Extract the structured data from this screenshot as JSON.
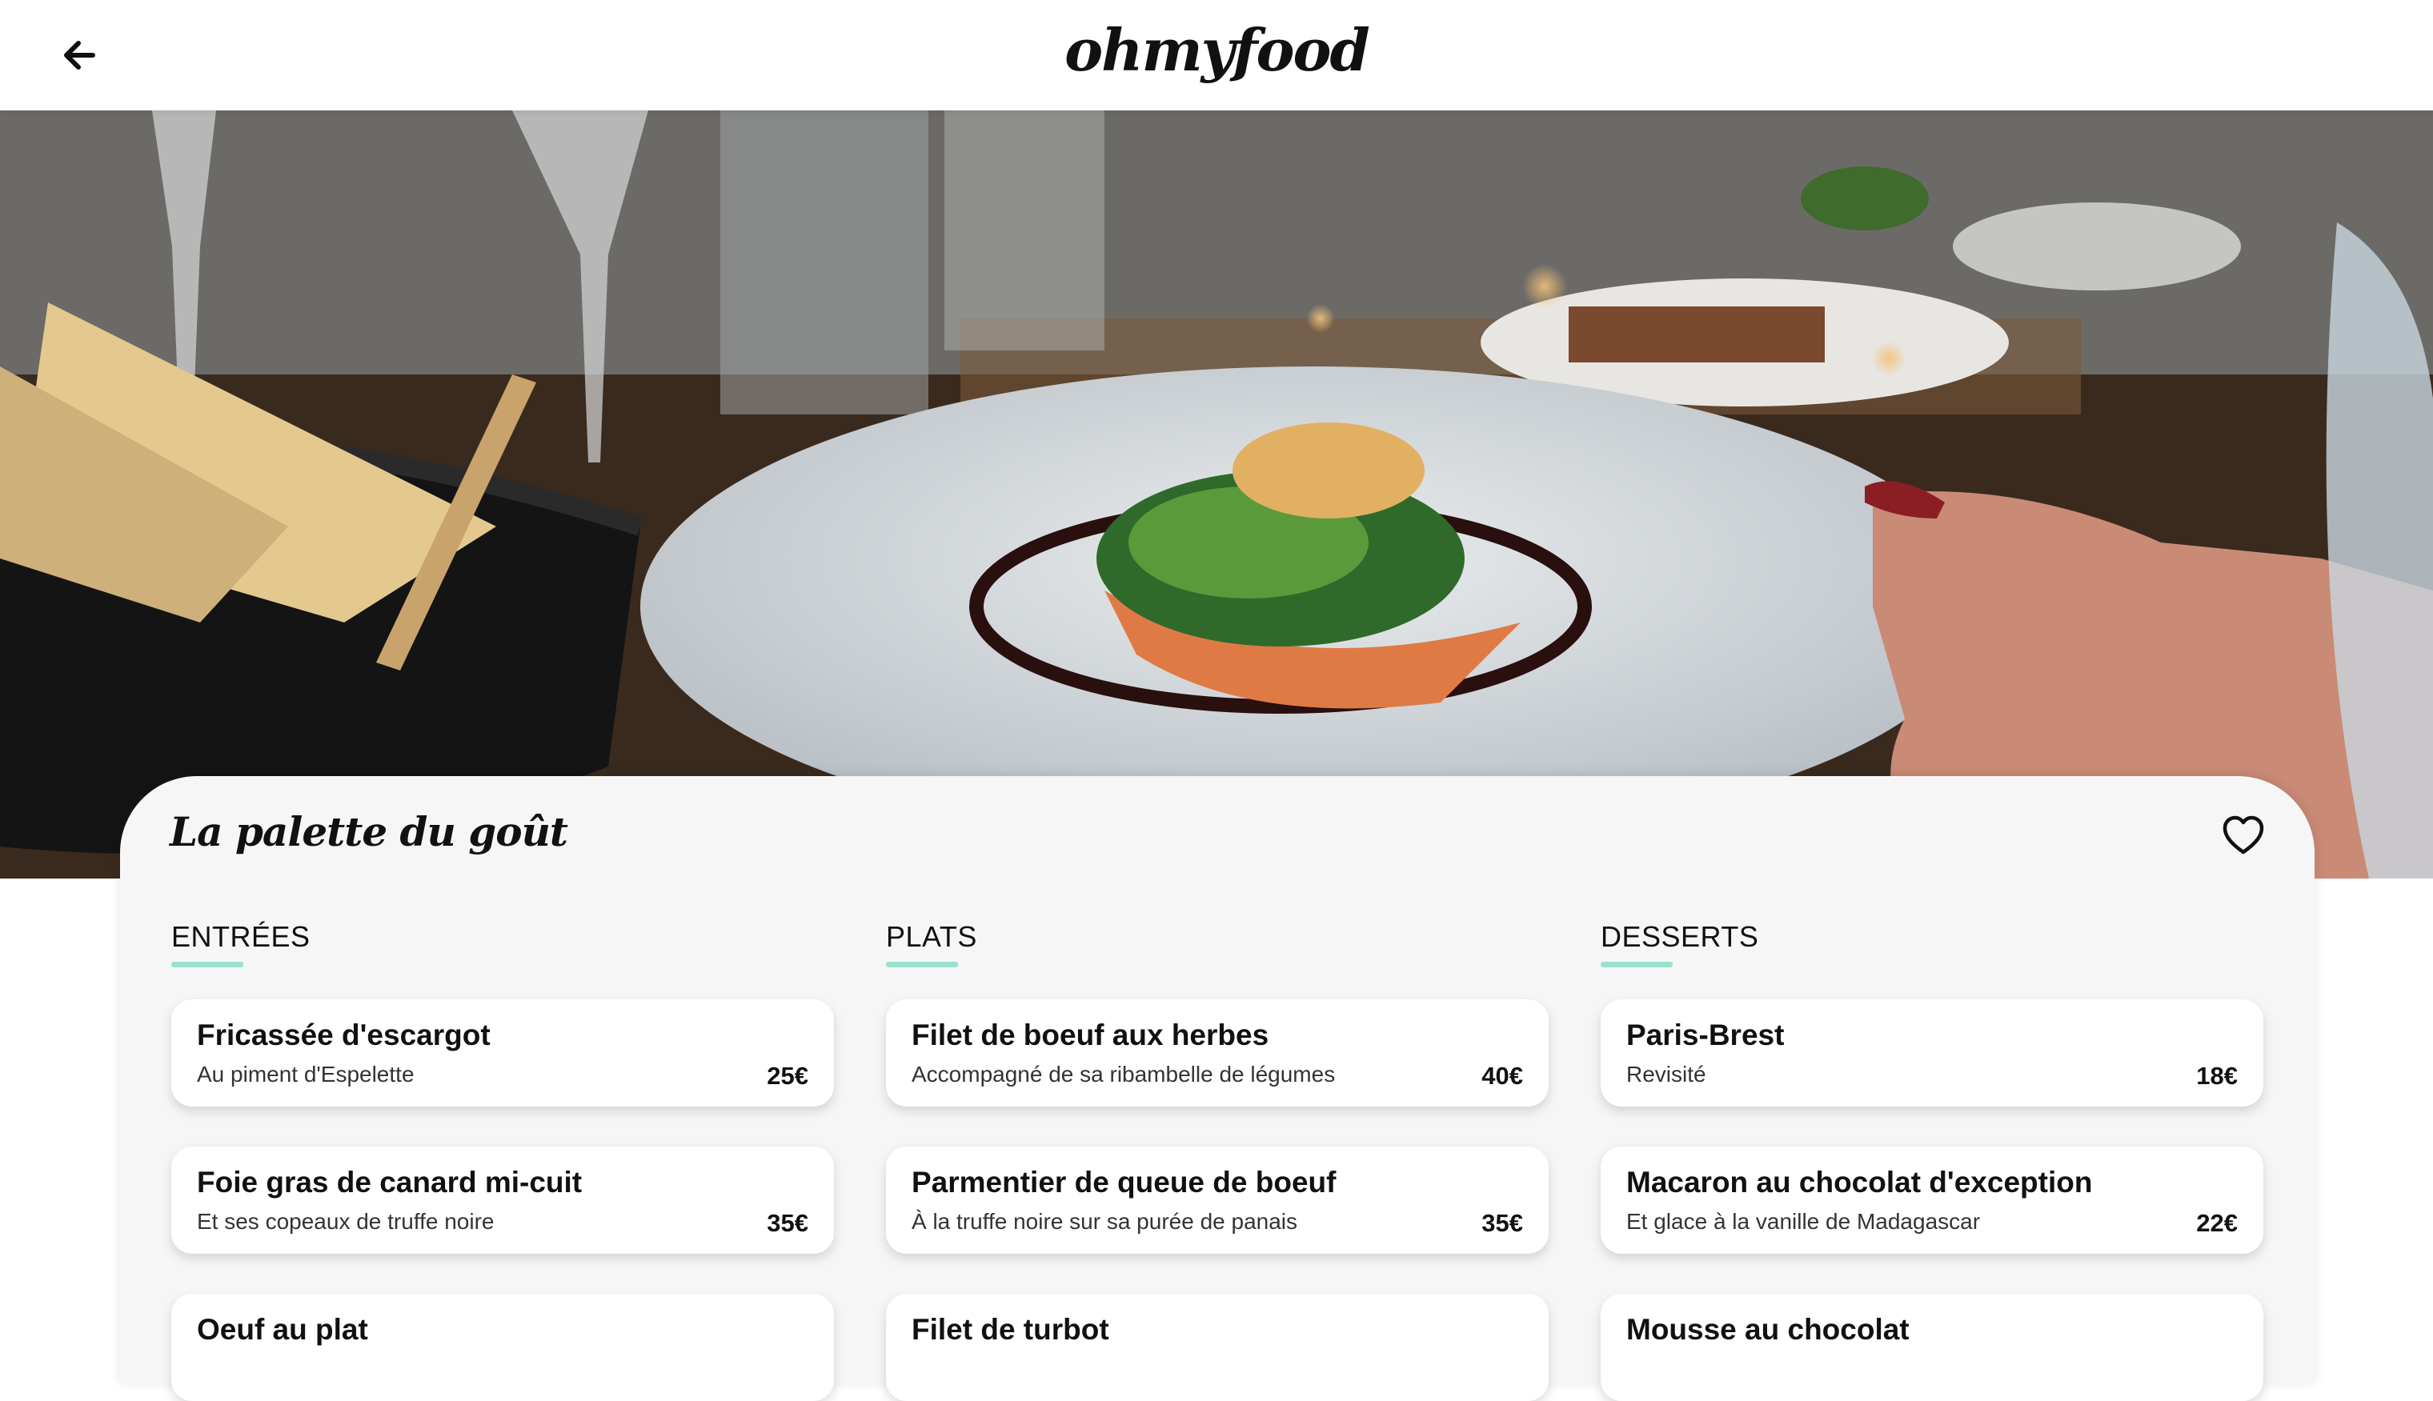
{
  "header": {
    "logo": "ohmyfood",
    "back_icon": "arrow-left-icon"
  },
  "restaurant": {
    "name": "La palette du goût",
    "favorite_icon": "heart-outline-icon"
  },
  "colors": {
    "accent": "#99e2d0",
    "card_background": "#f6f6f6"
  },
  "menu": [
    {
      "title": "ENTRÉES",
      "dishes": [
        {
          "name": "Fricassée d'escargot",
          "desc": "Au piment d'Espelette",
          "price": "25€"
        },
        {
          "name": "Foie gras de canard mi-cuit",
          "desc": "Et ses copeaux de truffe noire",
          "price": "35€"
        },
        {
          "name": "Oeuf au plat",
          "desc": "",
          "price": ""
        }
      ]
    },
    {
      "title": "PLATS",
      "dishes": [
        {
          "name": "Filet de boeuf aux herbes",
          "desc": "Accompagné de sa ribambelle de légumes",
          "price": "40€"
        },
        {
          "name": "Parmentier de queue de boeuf",
          "desc": "À la truffe noire sur sa purée de panais",
          "price": "35€"
        },
        {
          "name": "Filet de turbot",
          "desc": "",
          "price": ""
        }
      ]
    },
    {
      "title": "DESSERTS",
      "dishes": [
        {
          "name": "Paris-Brest",
          "desc": "Revisité",
          "price": "18€"
        },
        {
          "name": "Macaron au chocolat d'exception",
          "desc": "Et glace à la vanille de Madagascar",
          "price": "22€"
        },
        {
          "name": "Mousse au chocolat",
          "desc": "",
          "price": ""
        }
      ]
    }
  ]
}
